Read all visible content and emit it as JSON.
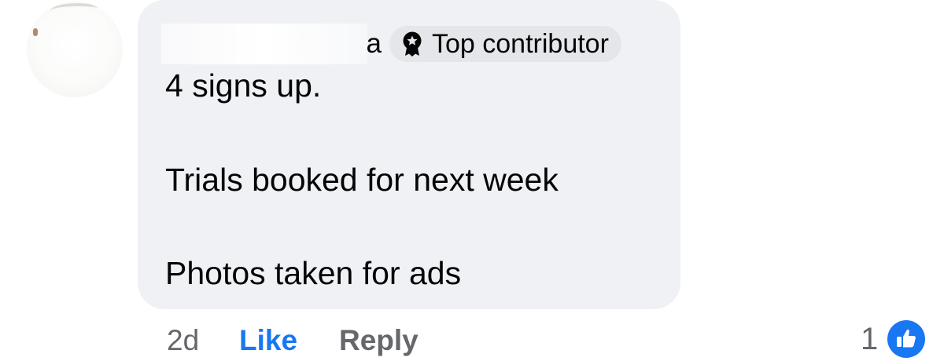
{
  "comment": {
    "author_visible_suffix": "a",
    "badge_label": "Top contributor",
    "badge_icon": "award-medal-icon",
    "lines": [
      "4 signs up.",
      "Trials booked for next week",
      "Photos taken for ads"
    ]
  },
  "actions": {
    "timestamp": "2d",
    "like_label": "Like",
    "reply_label": "Reply"
  },
  "reactions": {
    "count": "1",
    "icon": "thumbs-up-icon"
  },
  "colors": {
    "bubble_bg": "#eff1f5",
    "badge_bg": "#e4e6ea",
    "like_blue": "#1877f2",
    "secondary_text": "#65676b",
    "primary_text": "#050505"
  }
}
